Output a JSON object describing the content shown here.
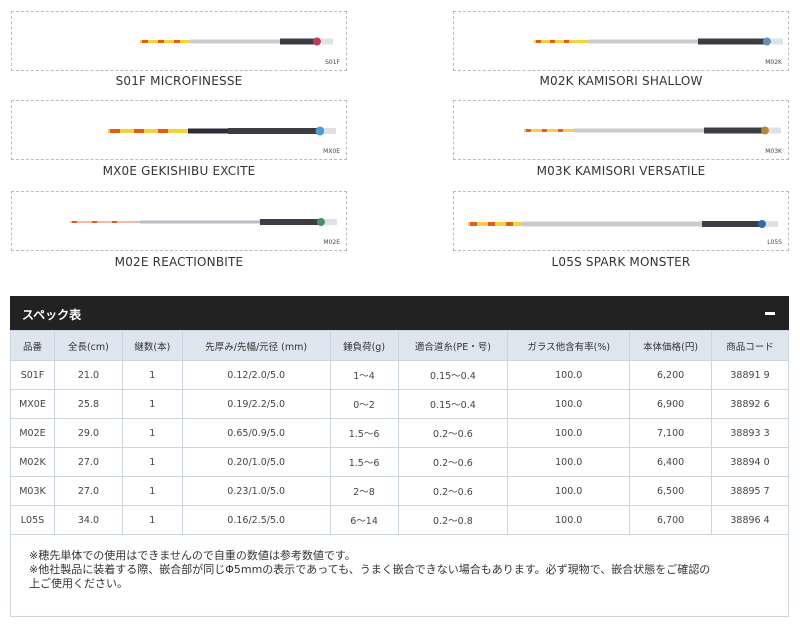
{
  "products": [
    {
      "name": "S01F MICROFINESSE",
      "code": "S01F"
    },
    {
      "name": "M02K KAMISORI SHALLOW",
      "code": "M02K"
    },
    {
      "name": "MX0E GEKISHIBU EXCITE",
      "code": "MX0E"
    },
    {
      "name": "M03K KAMISORI VERSATILE",
      "code": "M03K"
    },
    {
      "name": "M02E REACTIONBITE",
      "code": "M02E"
    },
    {
      "name": "L05S SPARK MONSTER",
      "code": "L05S"
    }
  ],
  "spec": {
    "title": "スペック表",
    "headers": [
      "品番",
      "全長(cm)",
      "継数(本)",
      "先厚み/先幅/元径 (mm)",
      "錘負荷(g)",
      "適合道糸(PE・号)",
      "ガラス他含有率(%)",
      "本体価格(円)",
      "商品コード"
    ],
    "rows": [
      [
        "S01F",
        "21.0",
        "1",
        "0.12/2.0/5.0",
        "1～4",
        "0.15～0.4",
        "100.0",
        "6,200",
        "38891 9"
      ],
      [
        "MX0E",
        "25.8",
        "1",
        "0.19/2.2/5.0",
        "0～2",
        "0.15～0.4",
        "100.0",
        "6,900",
        "38892 6"
      ],
      [
        "M02E",
        "29.0",
        "1",
        "0.65/0.9/5.0",
        "1.5～6",
        "0.2～0.6",
        "100.0",
        "7,100",
        "38893 3"
      ],
      [
        "M02K",
        "27.0",
        "1",
        "0.20/1.0/5.0",
        "1.5～6",
        "0.2～0.6",
        "100.0",
        "6,400",
        "38894 0"
      ],
      [
        "M03K",
        "27.0",
        "1",
        "0.23/1.0/5.0",
        "2～8",
        "0.2～0.6",
        "100.0",
        "6,500",
        "38895 7"
      ],
      [
        "L05S",
        "34.0",
        "1",
        "0.16/2.5/5.0",
        "6～14",
        "0.2～0.8",
        "100.0",
        "6,700",
        "38896 4"
      ]
    ],
    "notes": [
      "※穂先単体での使用はできませんので自重の数値は参考数値です。",
      "※他社製品に装着する際、嵌合部が同じΦ5mmの表示であっても、うまく嵌合できない場合もあります。必ず現物で、嵌合状態をご確認の",
      "上ご使用ください。"
    ]
  }
}
